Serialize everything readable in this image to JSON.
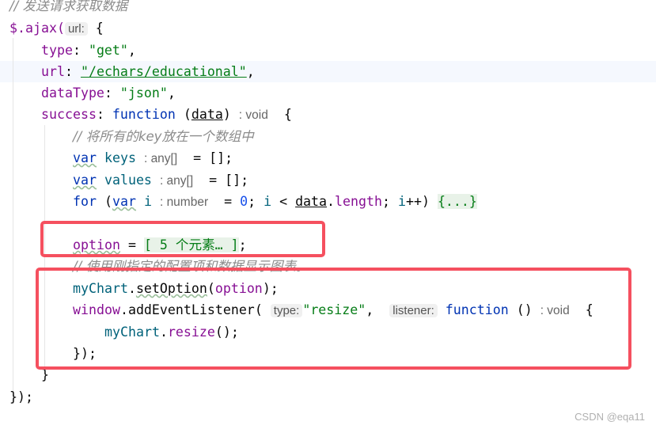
{
  "code": {
    "comment1": "// 发送请求获取数据",
    "ajax": "$.ajax(",
    "hint_url": "url:",
    "brace": " {",
    "type_key": "type",
    "type_val": "\"get\"",
    "url_key": "url",
    "url_val": "\"/echars/educational\"",
    "dt_key": "dataType",
    "dt_val": "\"json\"",
    "succ_key": "success",
    "function": "function",
    "data_param": "data",
    "void": ": void",
    "comment2": "// 将所有的key放在一个数组中",
    "var": "var",
    "keys": "keys",
    "any_arr": ": any[]",
    "values": "values",
    "i": "i",
    "number": ": number",
    "zero": "0",
    "data_length": "data",
    "length": "length",
    "folded_for": "{...}",
    "option": "option",
    "folded_array": "[ 5 个元素… ]",
    "comment3": "// 使用刚指定的配置项和数据显示图表。",
    "mychart": "myChart",
    "setoption": "setOption",
    "window": "window",
    "addlistener": "addEventListener",
    "hint_type": "type:",
    "resize_str": "\"resize\"",
    "hint_listener": "listener:",
    "resize": "resize"
  },
  "watermark": "CSDN @eqa11",
  "highlight_color": "#f5505f"
}
